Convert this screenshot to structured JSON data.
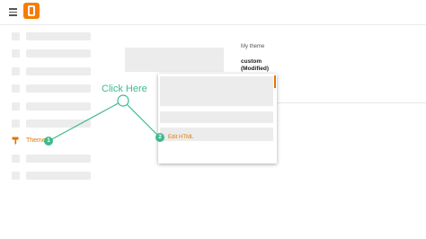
{
  "sidebar": {
    "active_item_label": "Theme"
  },
  "main": {
    "my_theme_label": "My theme",
    "theme_name_line1": "custom",
    "theme_name_line2": "(Modified)"
  },
  "menu": {
    "edit_html_label": "Edit HTML"
  },
  "annotation": {
    "click_here": "Click Here",
    "step1": "1",
    "step2": "2"
  },
  "colors": {
    "accent": "#e37400",
    "annotation": "#3dba8a",
    "logo": "#f57d00",
    "placeholder": "#ececec"
  },
  "icons": [
    "hamburger-menu-icon",
    "blogger-logo",
    "paint-roller-icon"
  ]
}
